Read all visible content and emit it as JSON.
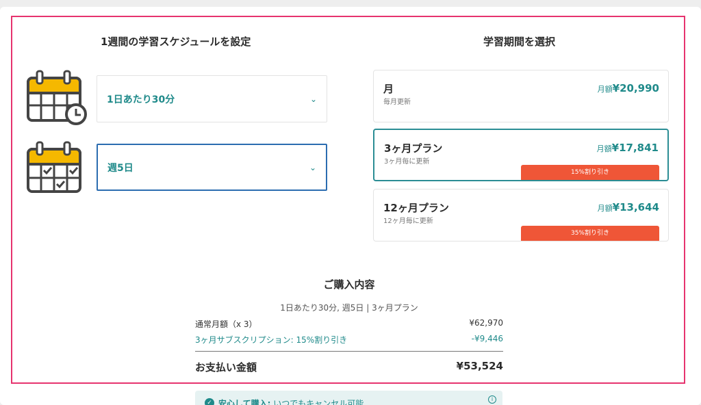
{
  "schedule": {
    "heading": "1週間の学習スケジュールを設定",
    "daily_time": {
      "value": "1日あたり30分",
      "icon": "calendar-clock-icon"
    },
    "days_per_week": {
      "value": "週5日",
      "icon": "calendar-check-icon"
    }
  },
  "period": {
    "heading": "学習期間を選択",
    "plans": [
      {
        "name": "月",
        "sub": "毎月更新",
        "price_label": "月額",
        "price": "¥20,990",
        "discount": ""
      },
      {
        "name": "3ヶ月プラン",
        "sub": "3ヶ月毎に更新",
        "price_label": "月額",
        "price": "¥17,841",
        "discount": "15%割り引き",
        "selected": true
      },
      {
        "name": "12ヶ月プラン",
        "sub": "12ヶ月毎に更新",
        "price_label": "月額",
        "price": "¥13,644",
        "discount": "35%割り引き"
      }
    ]
  },
  "summary": {
    "title": "ご購入内容",
    "line": "1日あたり30分, 週5日 | 3ヶ月プラン",
    "rows": [
      {
        "label": "通常月額（x 3）",
        "value": "¥62,970"
      },
      {
        "label": "3ヶ月サブスクリプション: 15%割り引き",
        "value": "-¥9,446"
      }
    ],
    "total_label": "お支払い金額",
    "total_value": "¥53,524"
  },
  "notice": {
    "strong": "安心して購入:",
    "text": " いつでもキャンセル可能"
  },
  "colors": {
    "accent": "#1f8a8a",
    "discount": "#ef5637",
    "highlight": "#e6336e",
    "calendar": "#f5b800"
  }
}
